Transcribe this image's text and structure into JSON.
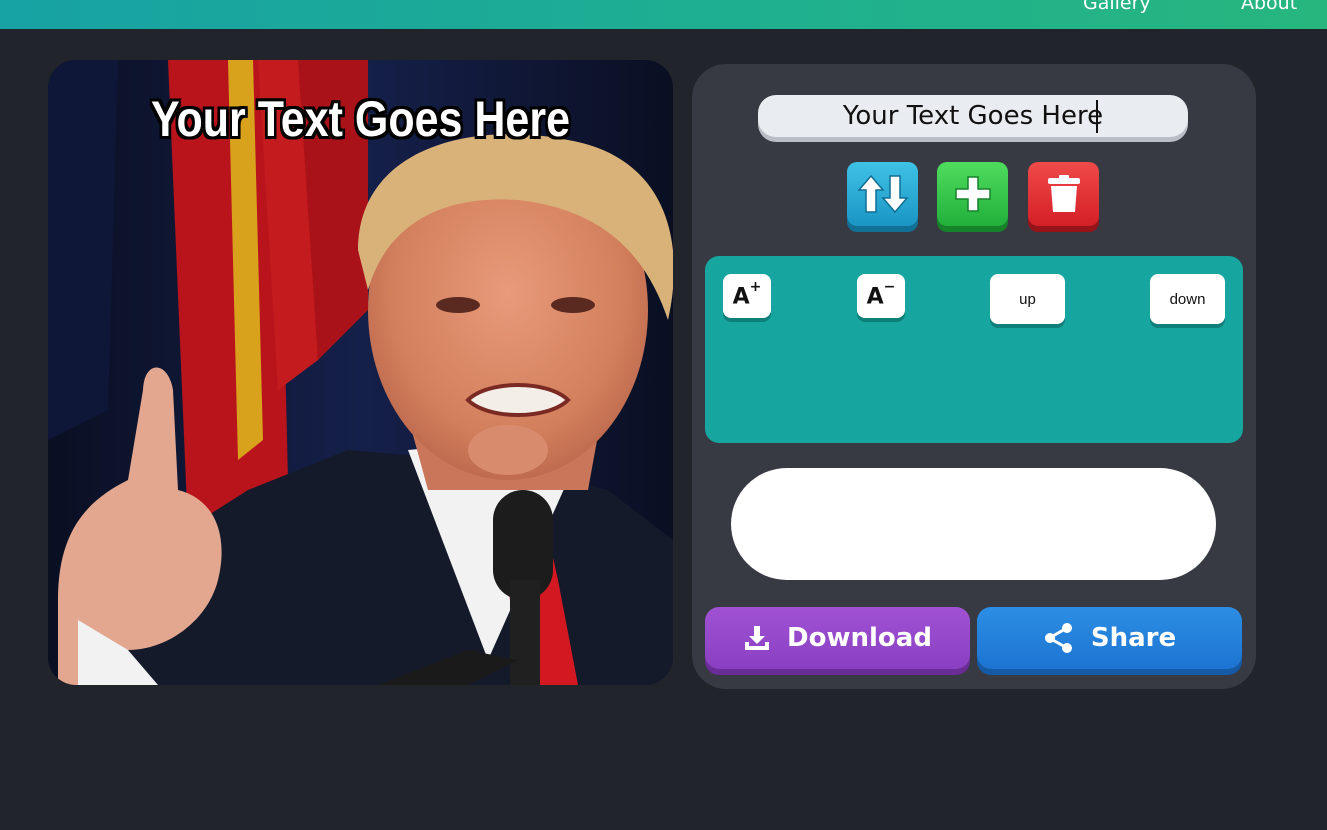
{
  "nav": {
    "gallery": "Gallery",
    "about": "About"
  },
  "meme": {
    "caption": "Your Text Goes Here"
  },
  "editor": {
    "text_value": "Your Text Goes Here",
    "icons": {
      "swap": "swap-updown-icon",
      "add": "plus-icon",
      "delete": "trash-icon"
    },
    "controls": {
      "font_up_label": "A",
      "font_up_mark": "+",
      "font_down_label": "A",
      "font_down_mark": "−",
      "up_label": "up",
      "down_label": "down"
    },
    "download_label": "Download",
    "share_label": "Share"
  },
  "colors": {
    "accent_teal": "#17a69f",
    "download": "#8a3fc2",
    "share": "#1d74d2",
    "add": "#22b03b",
    "delete": "#d41f26",
    "swap": "#1a95c4"
  }
}
